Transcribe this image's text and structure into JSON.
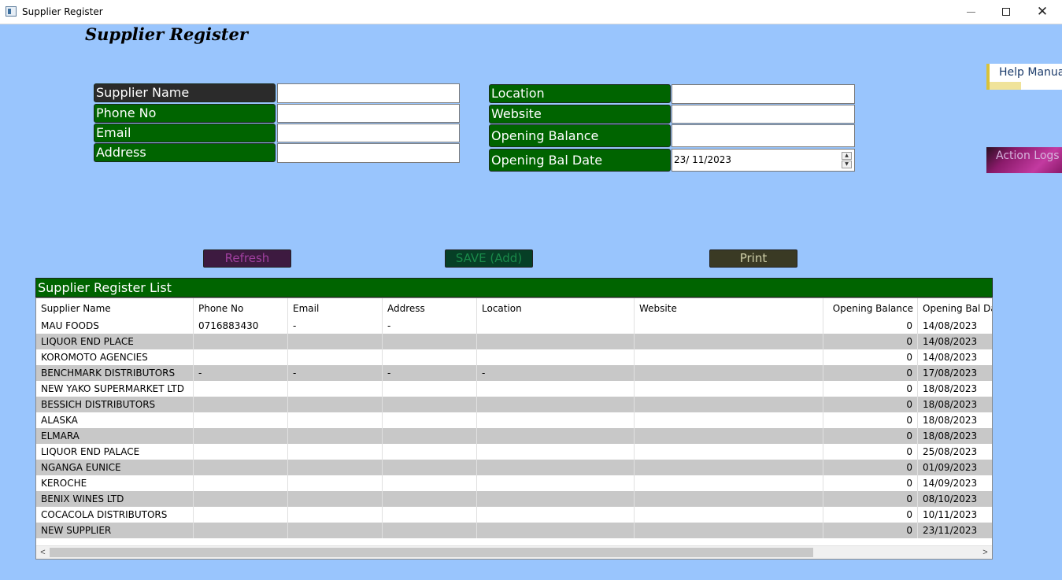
{
  "window": {
    "title": "Supplier Register",
    "minimize": "—",
    "maximize": "",
    "close": "✕"
  },
  "page_title": "Supplier Register",
  "form": {
    "left": [
      {
        "label": "Supplier Name",
        "value": ""
      },
      {
        "label": "Phone No",
        "value": ""
      },
      {
        "label": "Email",
        "value": ""
      },
      {
        "label": "Address",
        "value": ""
      }
    ],
    "right": [
      {
        "label": "Location",
        "value": ""
      },
      {
        "label": "Website",
        "value": ""
      },
      {
        "label": "Opening Balance",
        "value": ""
      },
      {
        "label": "Opening Bal Date",
        "value": "23/ 11/2023"
      }
    ]
  },
  "side_buttons": {
    "help": "Help Manual",
    "logs": "Action Logs"
  },
  "buttons": {
    "refresh": "Refresh",
    "save": "SAVE (Add)",
    "print": "Print"
  },
  "spin": {
    "up": "▲",
    "down": "▼"
  },
  "list": {
    "title": "Supplier Register List",
    "columns": [
      "Supplier Name",
      "Phone No",
      "Email",
      "Address",
      "Location",
      "Website",
      "Opening Balance",
      "Opening Bal Date"
    ],
    "rows": [
      [
        "MAU FOODS",
        "0716883430",
        "-",
        "-",
        "",
        "",
        "0",
        "14/08/2023"
      ],
      [
        "LIQUOR END PLACE",
        "",
        "",
        "",
        "",
        "",
        "0",
        "14/08/2023"
      ],
      [
        "KOROMOTO AGENCIES",
        "",
        "",
        "",
        "",
        "",
        "0",
        "14/08/2023"
      ],
      [
        "BENCHMARK DISTRIBUTORS",
        "-",
        "-",
        "-",
        "-",
        "",
        "0",
        "17/08/2023"
      ],
      [
        "NEW YAKO SUPERMARKET LTD",
        "",
        "",
        "",
        "",
        "",
        "0",
        "18/08/2023"
      ],
      [
        "BESSICH DISTRIBUTORS",
        "",
        "",
        "",
        "",
        "",
        "0",
        "18/08/2023"
      ],
      [
        "ALASKA",
        "",
        "",
        "",
        "",
        "",
        "0",
        "18/08/2023"
      ],
      [
        "ELMARA",
        "",
        "",
        "",
        "",
        "",
        "0",
        "18/08/2023"
      ],
      [
        "LIQUOR END PALACE",
        "",
        "",
        "",
        "",
        "",
        "0",
        "25/08/2023"
      ],
      [
        "NGANGA EUNICE",
        "",
        "",
        "",
        "",
        "",
        "0",
        "01/09/2023"
      ],
      [
        "KEROCHE",
        "",
        "",
        "",
        "",
        "",
        "0",
        "14/09/2023"
      ],
      [
        "BENIX WINES LTD",
        "",
        "",
        "",
        "",
        "",
        "0",
        "08/10/2023"
      ],
      [
        "COCACOLA DISTRIBUTORS",
        "",
        "",
        "",
        "",
        "",
        "0",
        "10/11/2023"
      ],
      [
        "NEW SUPPLIER",
        "",
        "",
        "",
        "",
        "",
        "0",
        "23/11/2023"
      ]
    ]
  },
  "scroll": {
    "left": "<",
    "right": ">"
  }
}
